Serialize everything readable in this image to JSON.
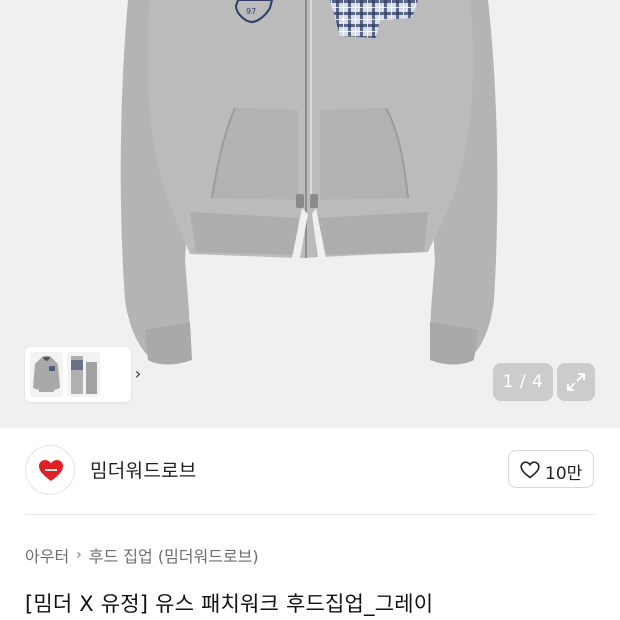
{
  "gallery": {
    "counter": "1 / 4",
    "thumb_next_glyph": "›",
    "thumbnails": [
      "hoodie-front-thumb",
      "hoodie-detail-thumb"
    ],
    "expand_icon": "expand-arrows-icon",
    "colors": {
      "background": "#f0f0f0",
      "hoodie": "#b6b6b6",
      "plaid_navy": "#2f3d66"
    }
  },
  "brand": {
    "name": "밈더워드로브",
    "like_count": "10만",
    "logo_icon": "red-heart-icon",
    "like_icon": "heart-outline-icon",
    "logo_color": "#e01e25"
  },
  "breadcrumb": {
    "category": "아우터",
    "separator": "›",
    "subcategory": "후드 집업 (밈더워드로브)"
  },
  "product": {
    "title": "[밈더 X 유정] 유스 패치워크 후드집업_그레이"
  }
}
